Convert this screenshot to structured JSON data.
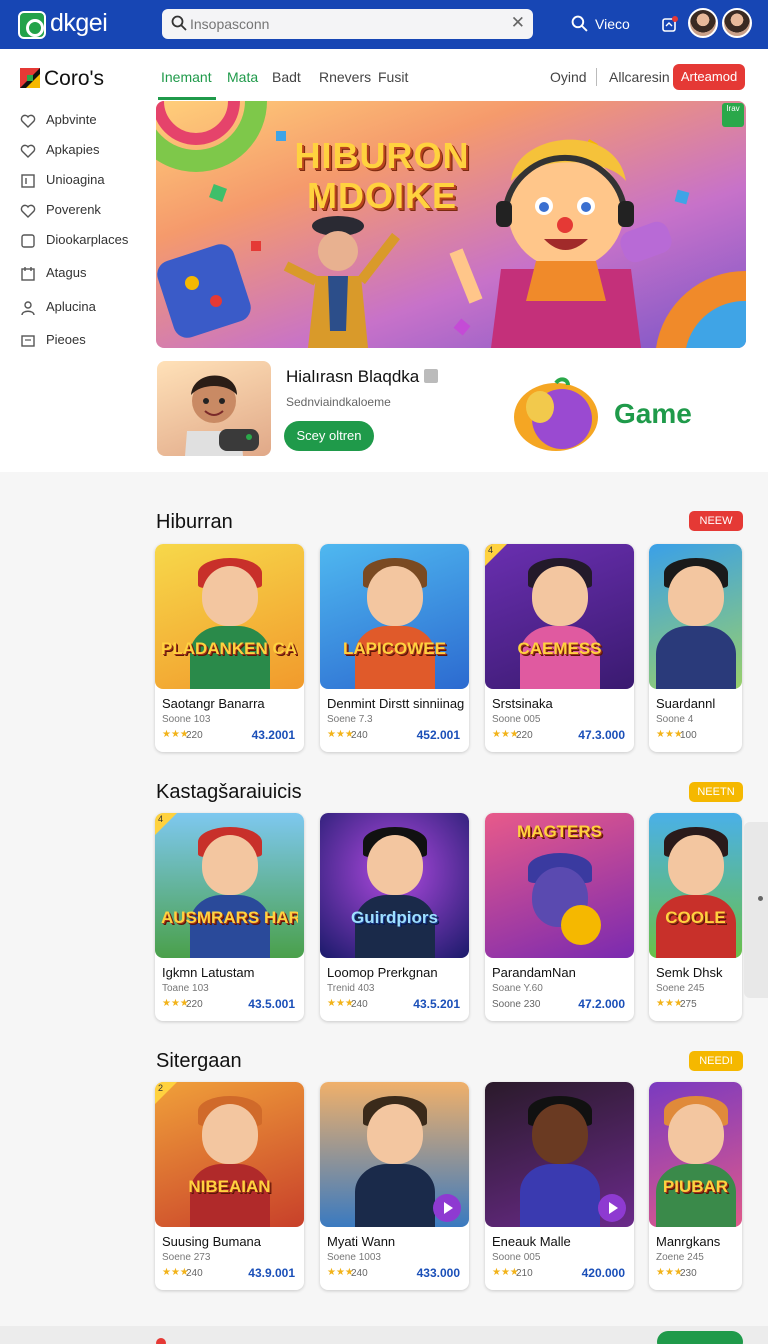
{
  "header": {
    "logo_text": "dkgei",
    "search_placeholder": "Insopasconn",
    "video_label": "Vieco"
  },
  "sidebar": {
    "brand": "Coro's",
    "items": [
      {
        "label": "Apbvinte",
        "icon": "heart-icon"
      },
      {
        "label": "Apkapies",
        "icon": "heart-icon"
      },
      {
        "label": "Unioagina",
        "icon": "bookmark-icon"
      },
      {
        "label": "Poverenk",
        "icon": "heart-icon"
      },
      {
        "label": "Diookarplaces",
        "icon": "square-icon"
      },
      {
        "label": "Atagus",
        "icon": "tag-icon"
      },
      {
        "label": "Aplucina",
        "icon": "user-icon"
      },
      {
        "label": "Pieoes",
        "icon": "image-icon"
      }
    ]
  },
  "nav": {
    "tabs": [
      "Inemant",
      "Mata",
      "Badt",
      "Rnevers",
      "Fusit"
    ],
    "right_links": [
      "Oyind",
      "Allcaresin"
    ],
    "action_button": "Arteamod"
  },
  "hero": {
    "title_line1": "HIBURON",
    "title_line2": "MDOIKE",
    "corner_badge": "Irav"
  },
  "featured": {
    "name": "Hialırasn Blaqdka",
    "subtitle": "Sednviaindkaloeme",
    "button": "Scey oltren",
    "game_label": "Game"
  },
  "sections": [
    {
      "title": "Hiburran",
      "badge": "NEEW",
      "badge_color": "#e53935",
      "cards": [
        {
          "art_title": "PLADANKEN CACTERLIEEN",
          "name": "Saotangr Banarra",
          "sub": "Soone 103",
          "rating": "220",
          "price": "43.2001"
        },
        {
          "art_title": "LAPICOWEE",
          "name": "Denmint Dirstt sinniinag",
          "sub": "Soene 7.3",
          "rating": "240",
          "price": "452.001"
        },
        {
          "art_title": "CAEMESS",
          "name": "Srstsinaka",
          "sub": "Soone 005",
          "rating": "220",
          "price": "47.3.000"
        },
        {
          "art_title": "",
          "name": "Suardannl",
          "sub": "Soone 4",
          "rating": "100",
          "price": ""
        }
      ]
    },
    {
      "title": "Kastagšaraiuicis",
      "badge": "NEETN",
      "badge_color": "#f5b800",
      "cards": [
        {
          "art_title": "AUSMRARS HARANES",
          "name": "Igkmn Latustam",
          "sub": "Toane 103",
          "rating": "220",
          "price": "43.5.001"
        },
        {
          "art_title": "Guirdpiors",
          "name": "Loomop Prerkgnan",
          "sub": "Trenid 403",
          "rating": "240",
          "price": "43.5.201"
        },
        {
          "art_title": "MAGTERS",
          "name": "ParandamNan",
          "sub": "Soane Y.60",
          "rating": "Soone 230",
          "price": "47.2.000"
        },
        {
          "art_title": "COOLE",
          "name": "Semk Dhsk",
          "sub": "Soene 245",
          "rating": "275",
          "price": ""
        }
      ]
    },
    {
      "title": "Sitergaan",
      "badge": "NEEDI",
      "badge_color": "#f5b800",
      "cards": [
        {
          "art_title": "NIBEAIAN",
          "name": "Suusing Bumana",
          "sub": "Soene 273",
          "rating": "240",
          "price": "43.9.001"
        },
        {
          "art_title": "",
          "name": "Myati Wann",
          "sub": "Soene 1003",
          "rating": "240",
          "price": "433.000"
        },
        {
          "art_title": "",
          "name": "Eneauk Malle",
          "sub": "Soone 005",
          "rating": "210",
          "price": "420.000"
        },
        {
          "art_title": "PIUBAR",
          "name": "Manrgkans",
          "sub": "Zoene 245",
          "rating": "230",
          "price": ""
        }
      ]
    }
  ]
}
